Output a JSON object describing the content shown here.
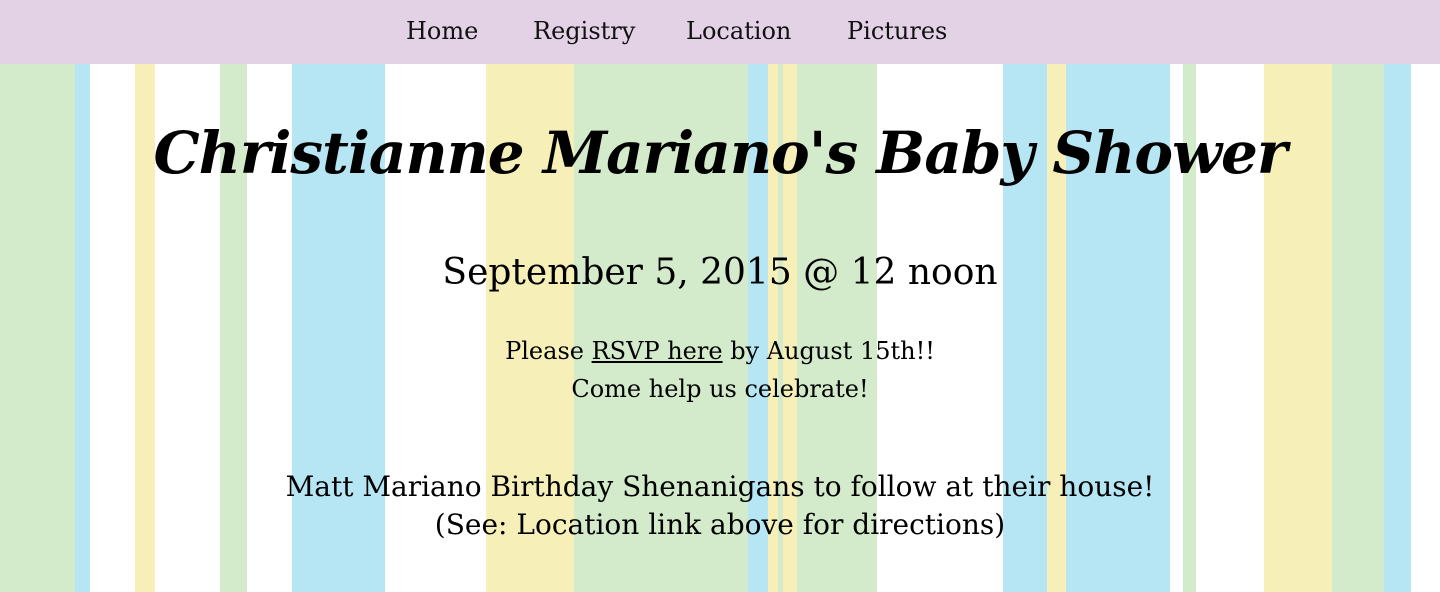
{
  "nav": {
    "home": "Home",
    "registry": "Registry",
    "location": "Location",
    "pictures": "Pictures"
  },
  "title": "Christianne Mariano's Baby Shower",
  "date": "September 5, 2015 @ 12 noon",
  "rsvp": {
    "prefix": "Please ",
    "link": "RSVP here",
    "suffix": " by August 15th!!",
    "line2": "Come help us celebrate!"
  },
  "followup": {
    "line1": "Matt Mariano Birthday Shenanigans to follow at their house!",
    "line2": "(See: Location link above for directions)"
  },
  "colors": {
    "nav_bg": "#e3d2e5",
    "stripe_green": "#d3ebcb",
    "stripe_blue": "#b6e6f4",
    "stripe_yellow": "#f6f0b8",
    "background": "#ffffff"
  }
}
